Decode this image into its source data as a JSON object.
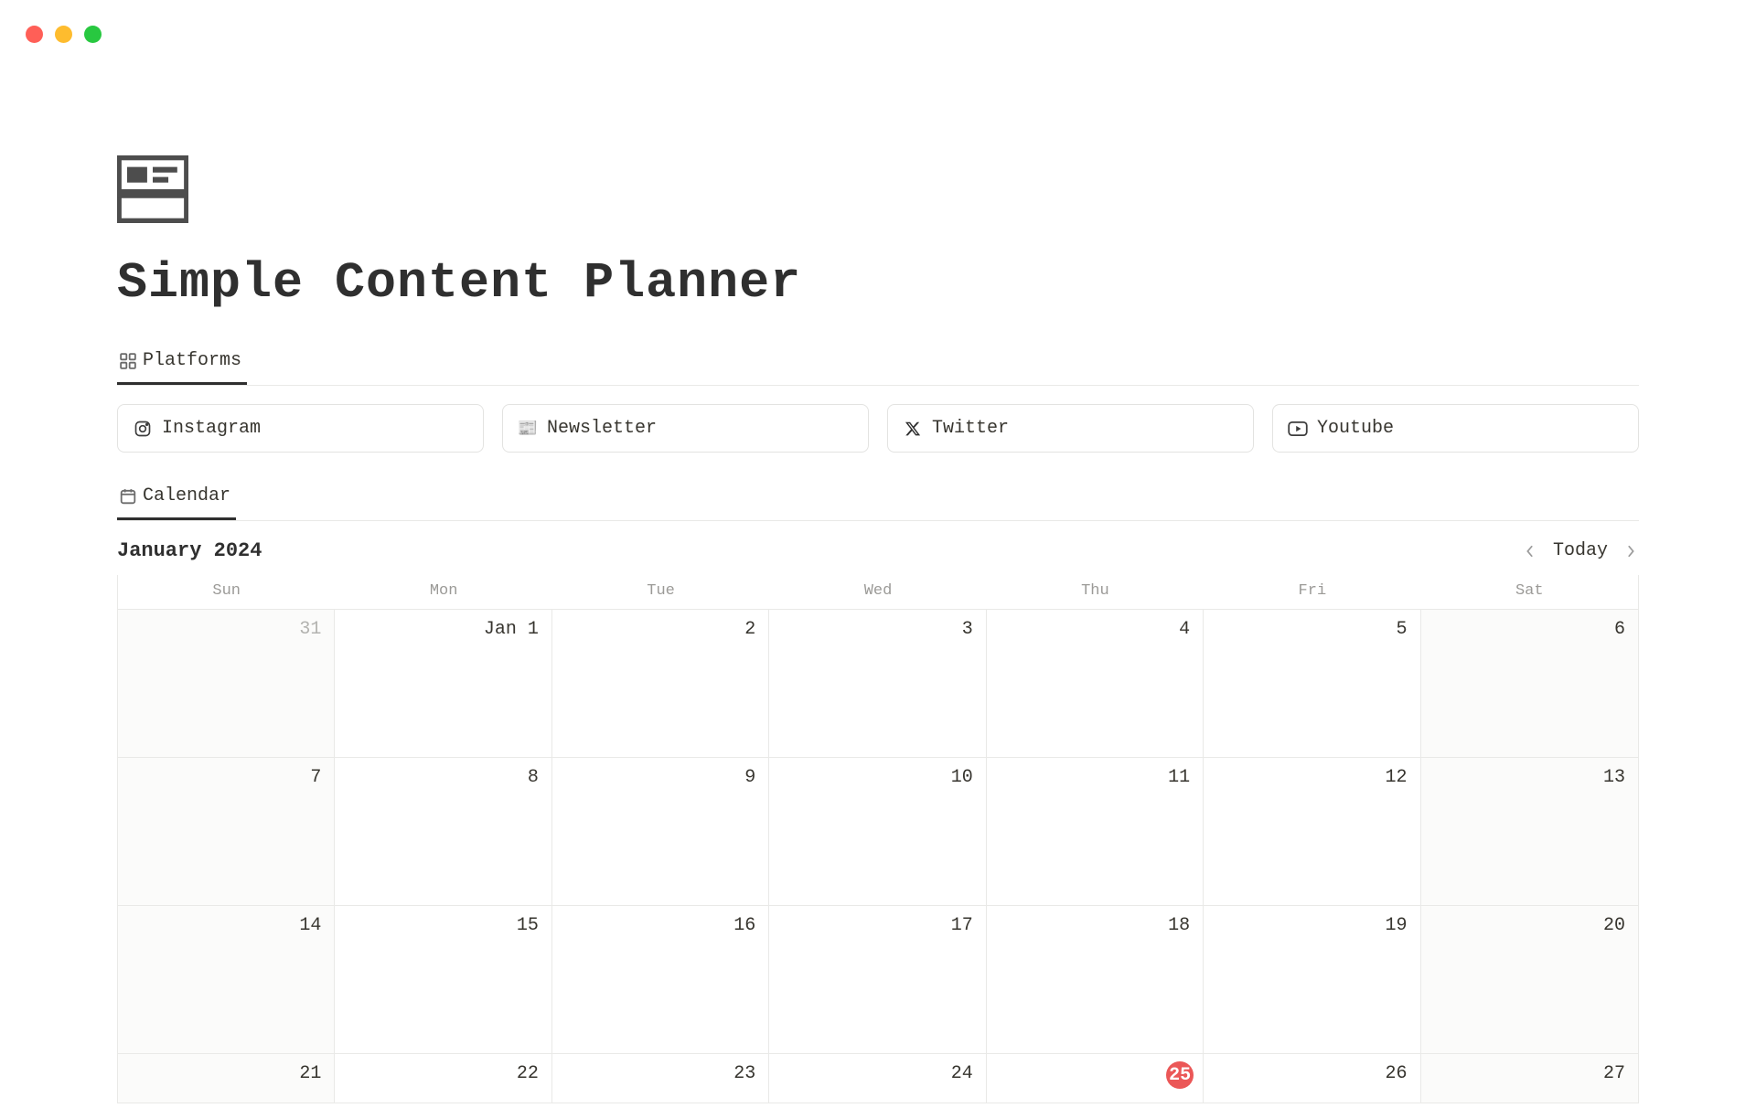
{
  "title": "Simple Content Planner",
  "tabs": {
    "platforms": "Platforms",
    "calendar": "Calendar"
  },
  "platforms": [
    {
      "name": "Instagram",
      "icon": "instagram"
    },
    {
      "name": "Newsletter",
      "icon": "newspaper"
    },
    {
      "name": "Twitter",
      "icon": "x"
    },
    {
      "name": "Youtube",
      "icon": "youtube"
    }
  ],
  "calendar": {
    "title": "January 2024",
    "today_label": "Today",
    "dow": [
      "Sun",
      "Mon",
      "Tue",
      "Wed",
      "Thu",
      "Fri",
      "Sat"
    ],
    "weeks": [
      [
        {
          "label": "31",
          "out": true,
          "weekend": true
        },
        {
          "label": "Jan 1"
        },
        {
          "label": "2"
        },
        {
          "label": "3"
        },
        {
          "label": "4"
        },
        {
          "label": "5"
        },
        {
          "label": "6",
          "weekend": true
        }
      ],
      [
        {
          "label": "7",
          "weekend": true
        },
        {
          "label": "8"
        },
        {
          "label": "9"
        },
        {
          "label": "10"
        },
        {
          "label": "11"
        },
        {
          "label": "12"
        },
        {
          "label": "13",
          "weekend": true
        }
      ],
      [
        {
          "label": "14",
          "weekend": true
        },
        {
          "label": "15"
        },
        {
          "label": "16"
        },
        {
          "label": "17"
        },
        {
          "label": "18"
        },
        {
          "label": "19"
        },
        {
          "label": "20",
          "weekend": true
        }
      ],
      [
        {
          "label": "21",
          "weekend": true
        },
        {
          "label": "22"
        },
        {
          "label": "23"
        },
        {
          "label": "24"
        },
        {
          "label": "25",
          "today": true
        },
        {
          "label": "26"
        },
        {
          "label": "27",
          "weekend": true
        }
      ]
    ]
  }
}
